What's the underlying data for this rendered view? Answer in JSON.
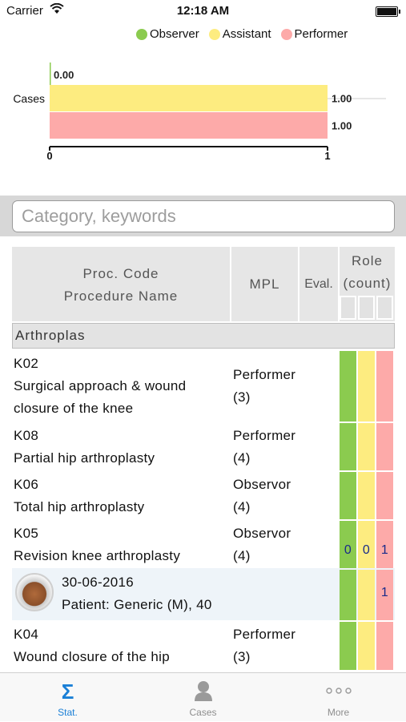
{
  "status_bar": {
    "carrier": "Carrier",
    "time": "12:18 AM"
  },
  "legend": [
    {
      "label": "Observer",
      "color": "#8bcb4f"
    },
    {
      "label": "Assistant",
      "color": "#fdec80"
    },
    {
      "label": "Performer",
      "color": "#fdaaa9"
    }
  ],
  "chart_data": {
    "type": "bar",
    "orientation": "horizontal",
    "categories": [
      "Cases"
    ],
    "series": [
      {
        "name": "Observer",
        "values": [
          0.0
        ],
        "label": "0.00",
        "color": "#8bcb4f"
      },
      {
        "name": "Assistant",
        "values": [
          1.0
        ],
        "label": "1.00",
        "color": "#fdec80"
      },
      {
        "name": "Performer",
        "values": [
          1.0
        ],
        "label": "1.00",
        "color": "#fdaaa9"
      }
    ],
    "xlim": [
      0,
      1
    ],
    "x_ticks": [
      "0",
      "1"
    ],
    "legend": "top"
  },
  "search": {
    "placeholder": "Category, keywords"
  },
  "table": {
    "headers": {
      "proc_code": "Proc. Code",
      "proc_name": "Procedure Name",
      "mpl": "MPL",
      "eval": "Eval.",
      "role": "Role",
      "role_count": "(count)"
    },
    "category": "Arthroplas",
    "rows": [
      {
        "code": "K02",
        "name": "Surgical approach & wound closure of the knee",
        "mpl_role": "Performer",
        "mpl_count": "(3)"
      },
      {
        "code": "K08",
        "name": "Partial hip arthroplasty",
        "mpl_role": "Performer",
        "mpl_count": "(4)"
      },
      {
        "code": "K06",
        "name": "Total hip arthroplasty",
        "mpl_role": "Observor",
        "mpl_count": "(4)"
      },
      {
        "code": "K05",
        "name": "Revision knee arthroplasty",
        "mpl_role": "Observor",
        "mpl_count": "(4)",
        "counts": [
          "0",
          "0",
          "1"
        ]
      }
    ],
    "case_row": {
      "date": "30-06-2016",
      "patient": "Patient: Generic (M), 40",
      "count": "1"
    },
    "last_row": {
      "code": "K04",
      "name": "Wound closure of the hip",
      "mpl_role": "Performer",
      "mpl_count": "(3)"
    }
  },
  "tabbar": [
    {
      "label": "Stat.",
      "icon": "sigma-icon",
      "active": true
    },
    {
      "label": "Cases",
      "icon": "person-icon",
      "active": false
    },
    {
      "label": "More",
      "icon": "more-dots-icon",
      "active": false
    }
  ]
}
